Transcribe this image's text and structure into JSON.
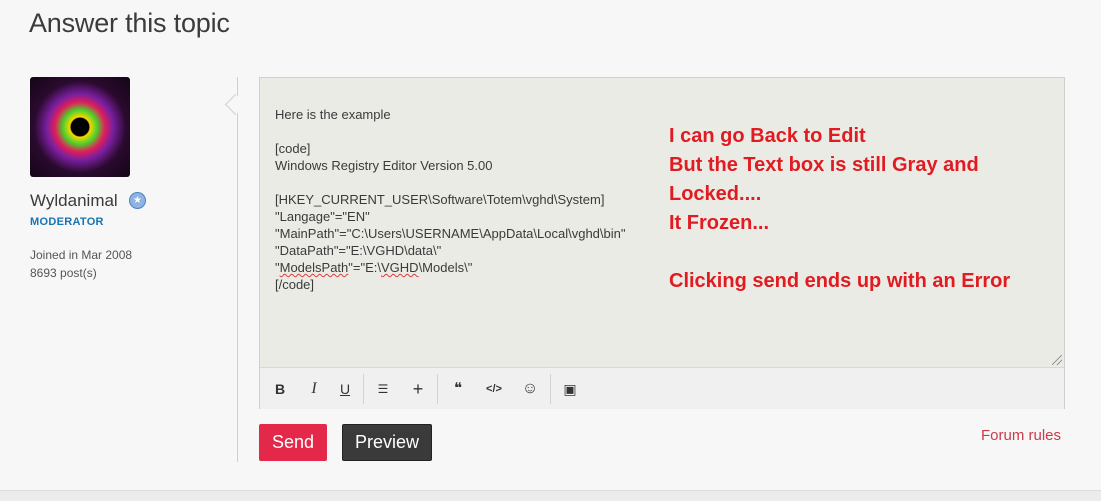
{
  "page": {
    "title": "Answer this topic"
  },
  "author": {
    "username": "Wyldanimal",
    "role": "MODERATOR",
    "joined": "Joined in Mar 2008",
    "posts": "8693 post(s)",
    "badge_icon": "star-icon"
  },
  "editor": {
    "lines": [
      "Here is the example",
      "",
      "[code]",
      "Windows Registry Editor Version 5.00",
      "",
      "[HKEY_CURRENT_USER\\Software\\Totem\\vghd\\System]",
      "\"Langage\"=\"EN\"",
      "\"MainPath\"=\"C:\\Users\\USERNAME\\AppData\\Local\\vghd\\bin\"",
      "\"DataPath\"=\"E:\\VGHD\\data\\\"",
      "\"ModelsPath\"=\"E:\\VGHD\\Models\\\"",
      "[/code]"
    ],
    "modelspath_line": {
      "a": "\"",
      "b": "ModelsPath",
      "c": "\"=\"E:\\",
      "d": "VGHD",
      "e": "\\Models\\\""
    },
    "annotation": [
      "I can go Back to Edit",
      "But the Text box is still Gray and",
      "Locked....",
      "It Frozen...",
      "",
      "Clicking send ends up with an Error"
    ],
    "annotation_color": "#e01b22",
    "toolbar": [
      {
        "name": "bold-button",
        "label": "B"
      },
      {
        "name": "italic-button",
        "label": "I"
      },
      {
        "name": "underline-button",
        "label": "U"
      },
      {
        "name": "list-button",
        "label": "☰"
      },
      {
        "name": "insert-button",
        "label": "+"
      },
      {
        "name": "quote-button",
        "label": "❝"
      },
      {
        "name": "code-button",
        "label": "</>"
      },
      {
        "name": "emoji-button",
        "label": "☺"
      },
      {
        "name": "image-button",
        "label": "▣"
      }
    ]
  },
  "actions": {
    "send_label": "Send",
    "preview_label": "Preview",
    "forum_rules_label": "Forum rules",
    "send_color": "#e3284a"
  }
}
